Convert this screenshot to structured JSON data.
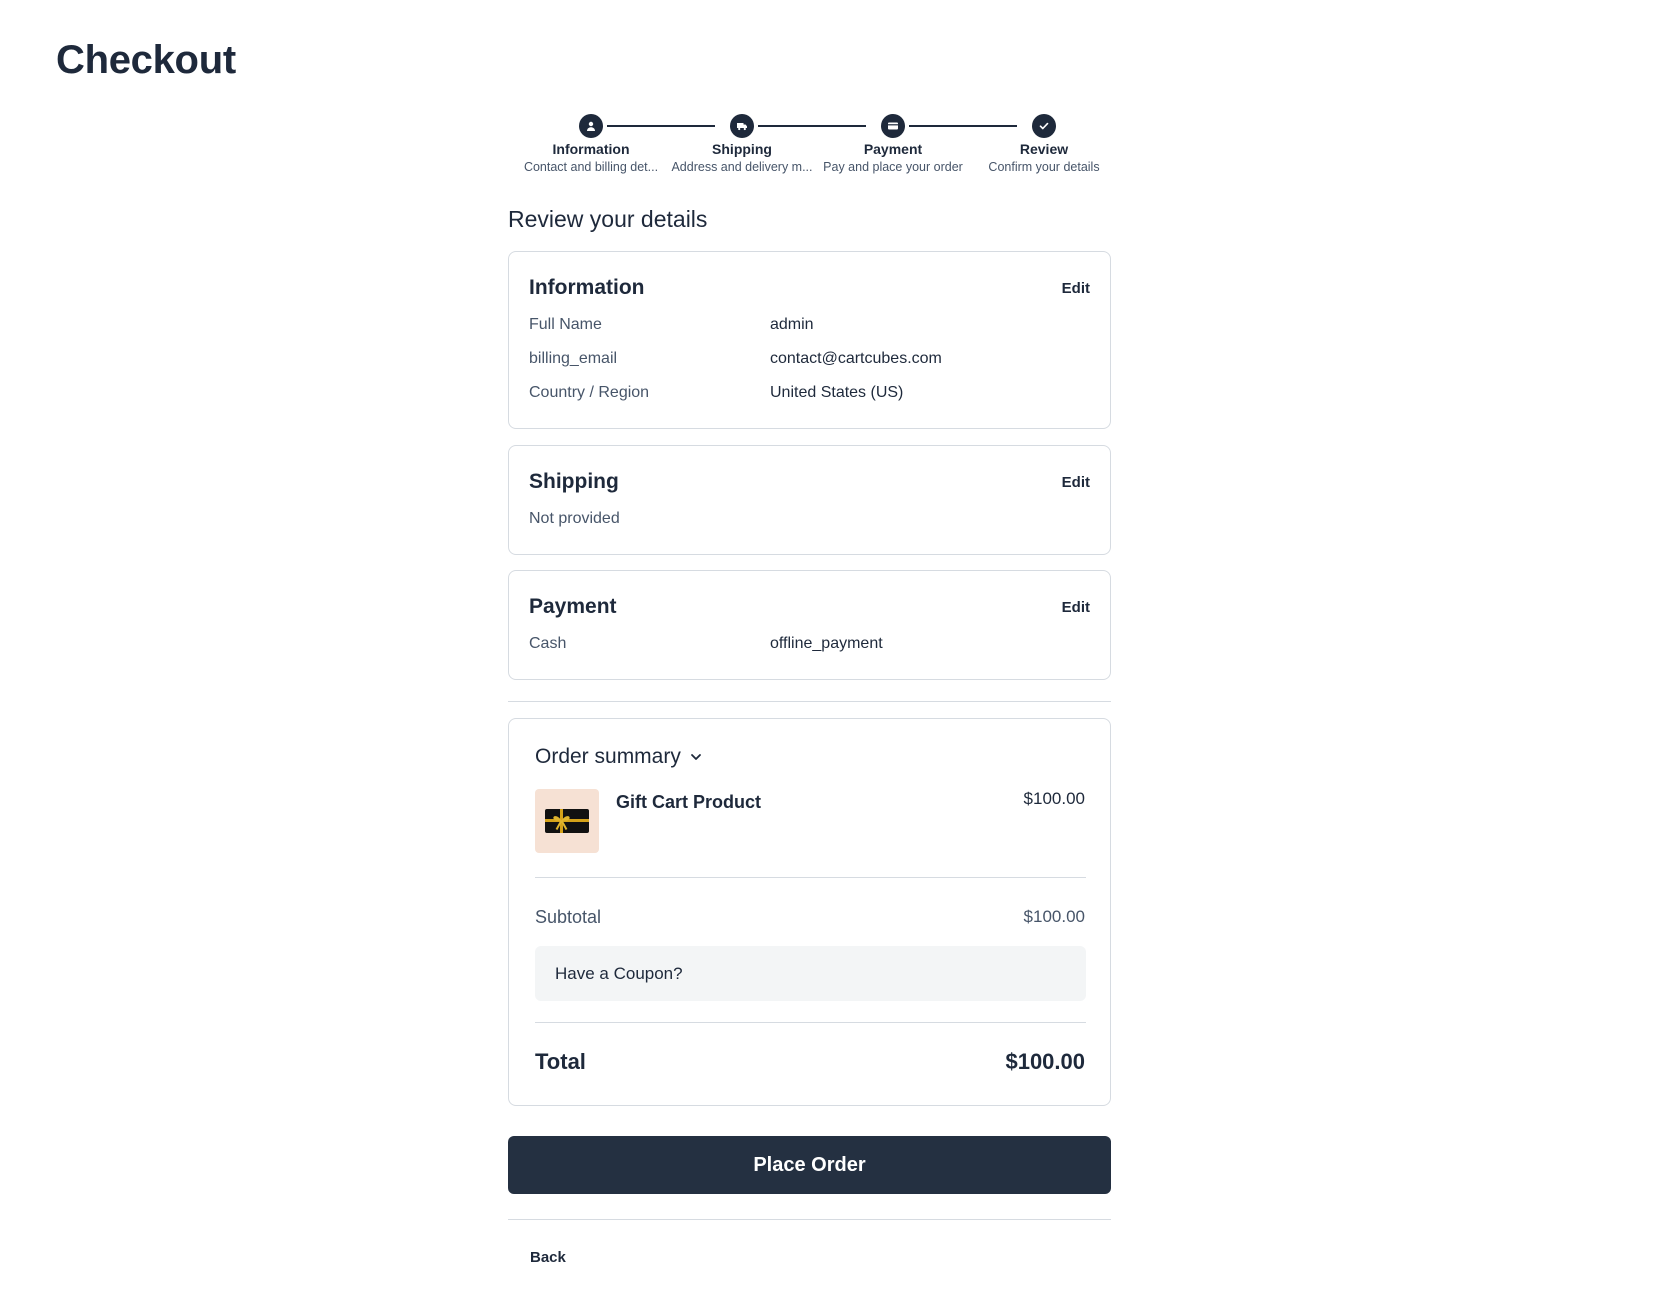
{
  "page": {
    "title": "Checkout"
  },
  "stepper": {
    "steps": [
      {
        "title": "Information",
        "subtitle": "Contact and billing det...",
        "icon": "user-icon"
      },
      {
        "title": "Shipping",
        "subtitle": "Address and delivery m...",
        "icon": "truck-icon"
      },
      {
        "title": "Payment",
        "subtitle": "Pay and place your order",
        "icon": "card-icon"
      },
      {
        "title": "Review",
        "subtitle": "Confirm your details",
        "icon": "check-icon"
      }
    ]
  },
  "review": {
    "heading": "Review your details",
    "information": {
      "title": "Information",
      "edit": "Edit",
      "rows": [
        {
          "key": "Full Name",
          "value": "admin"
        },
        {
          "key": "billing_email",
          "value": "contact@cartcubes.com"
        },
        {
          "key": "Country / Region",
          "value": "United States (US)"
        }
      ]
    },
    "shipping": {
      "title": "Shipping",
      "edit": "Edit",
      "empty": "Not provided"
    },
    "payment": {
      "title": "Payment",
      "edit": "Edit",
      "rows": [
        {
          "key": "Cash",
          "value": "offline_payment"
        }
      ]
    }
  },
  "summary": {
    "toggle": "Order summary",
    "product": {
      "name": "Gift Cart Product",
      "price": "$100.00",
      "icon": "gift-card-icon"
    },
    "subtotal_label": "Subtotal",
    "subtotal_value": "$100.00",
    "coupon": "Have a Coupon?",
    "total_label": "Total",
    "total_value": "$100.00"
  },
  "actions": {
    "place_order": "Place Order",
    "back": "Back"
  },
  "colors": {
    "primary": "#243041",
    "text": "#1e293b",
    "muted": "#475569",
    "border": "#d6dbe1"
  }
}
